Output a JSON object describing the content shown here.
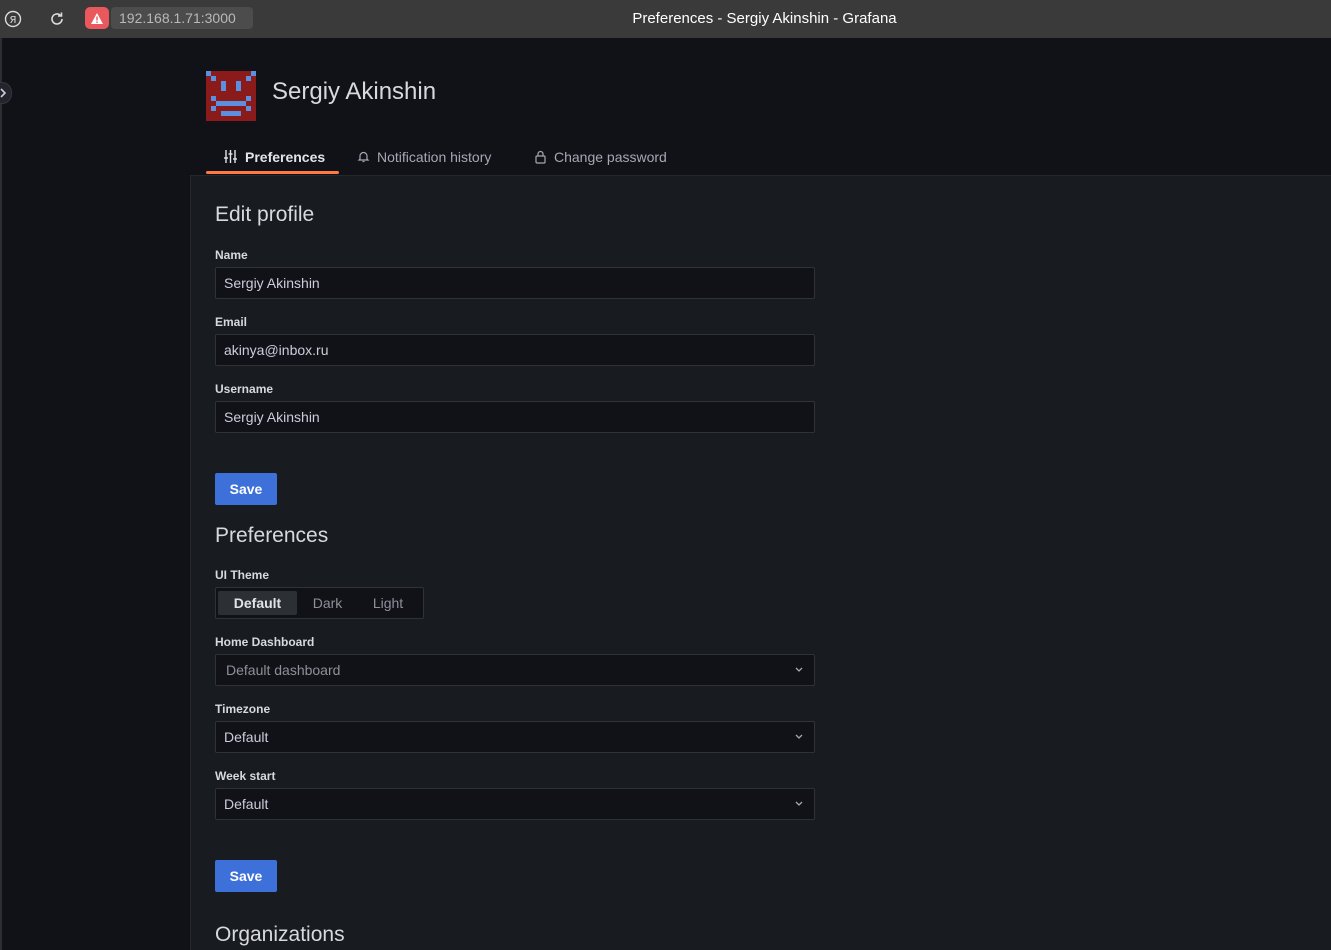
{
  "browser": {
    "url": "192.168.1.71:3000",
    "title": "Preferences - Sergiy Akinshin - Grafana"
  },
  "profile": {
    "display_name": "Sergiy Akinshin"
  },
  "tabs": [
    {
      "label": "Preferences",
      "icon": "sliders-icon",
      "active": true
    },
    {
      "label": "Notification history",
      "icon": "bell-icon",
      "active": false
    },
    {
      "label": "Change password",
      "icon": "lock-icon",
      "active": false
    }
  ],
  "edit_profile": {
    "heading": "Edit profile",
    "name_label": "Name",
    "name_value": "Sergiy Akinshin",
    "email_label": "Email",
    "email_value": "akinya@inbox.ru",
    "username_label": "Username",
    "username_value": "Sergiy Akinshin",
    "save_label": "Save"
  },
  "preferences": {
    "heading": "Preferences",
    "theme_label": "UI Theme",
    "theme_options": [
      "Default",
      "Dark",
      "Light"
    ],
    "theme_selected": "Default",
    "home_dashboard_label": "Home Dashboard",
    "home_dashboard_placeholder": "Default dashboard",
    "timezone_label": "Timezone",
    "timezone_value": "Default",
    "week_start_label": "Week start",
    "week_start_value": "Default",
    "save_label": "Save"
  },
  "organizations": {
    "heading": "Organizations"
  },
  "colors": {
    "primary_button": "#3d71d9",
    "active_tab_underline": "#ff7941",
    "avatar_bg": "#8b1a1a",
    "avatar_fg": "#5b8fe0"
  }
}
